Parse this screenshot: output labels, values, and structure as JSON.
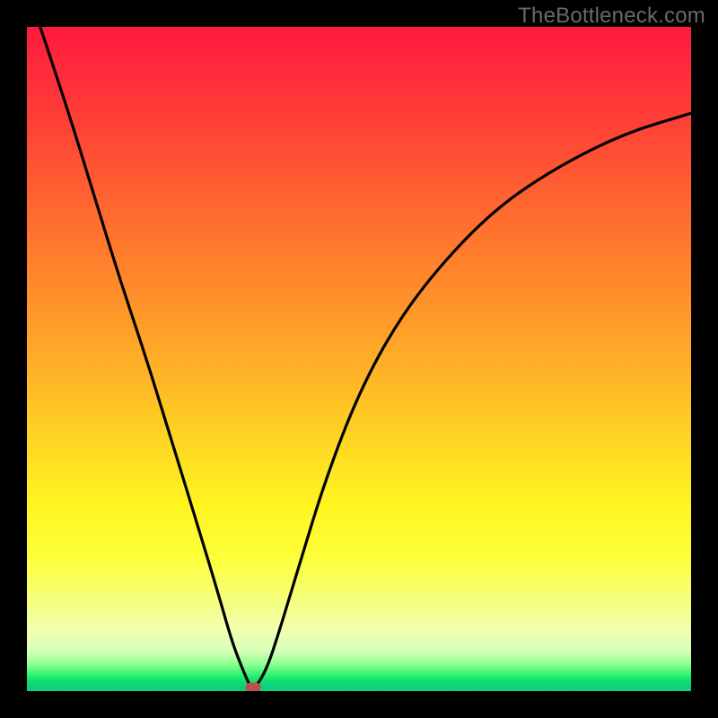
{
  "watermark": "TheBottleneck.com",
  "colors": {
    "frame_border": "#000000",
    "curve": "#000000",
    "marker": "#b85147",
    "gradient_top": "#ff1a3d",
    "gradient_mid_orange": "#ff8e2a",
    "gradient_yellow": "#fff51f",
    "gradient_green": "#13e66b"
  },
  "chart_data": {
    "type": "line",
    "title": "",
    "xlabel": "",
    "ylabel": "",
    "xlim": [
      0,
      100
    ],
    "ylim": [
      0,
      100
    ],
    "grid": false,
    "legend": false,
    "series": [
      {
        "name": "bottleneck-curve-left",
        "x": [
          2,
          6,
          10,
          14,
          18,
          22,
          26,
          29,
          31,
          33,
          34
        ],
        "y": [
          100,
          88,
          75,
          62,
          50,
          37,
          24,
          14,
          7,
          2,
          0
        ]
      },
      {
        "name": "bottleneck-curve-right",
        "x": [
          34,
          36,
          38,
          41,
          45,
          50,
          56,
          63,
          71,
          80,
          90,
          100
        ],
        "y": [
          0,
          3,
          9,
          19,
          32,
          45,
          56,
          65,
          73,
          79,
          84,
          87
        ]
      }
    ],
    "marker": {
      "x": 34,
      "y": 0.5
    },
    "background_gradient": {
      "orientation": "vertical",
      "stops": [
        {
          "pos": 0,
          "color": "#ff1a3d"
        },
        {
          "pos": 28,
          "color": "#ff6a2f"
        },
        {
          "pos": 52,
          "color": "#ffb327"
        },
        {
          "pos": 72,
          "color": "#fff51f"
        },
        {
          "pos": 91,
          "color": "#eeffb2"
        },
        {
          "pos": 97,
          "color": "#36f276"
        },
        {
          "pos": 100,
          "color": "#14cf7f"
        }
      ]
    }
  }
}
